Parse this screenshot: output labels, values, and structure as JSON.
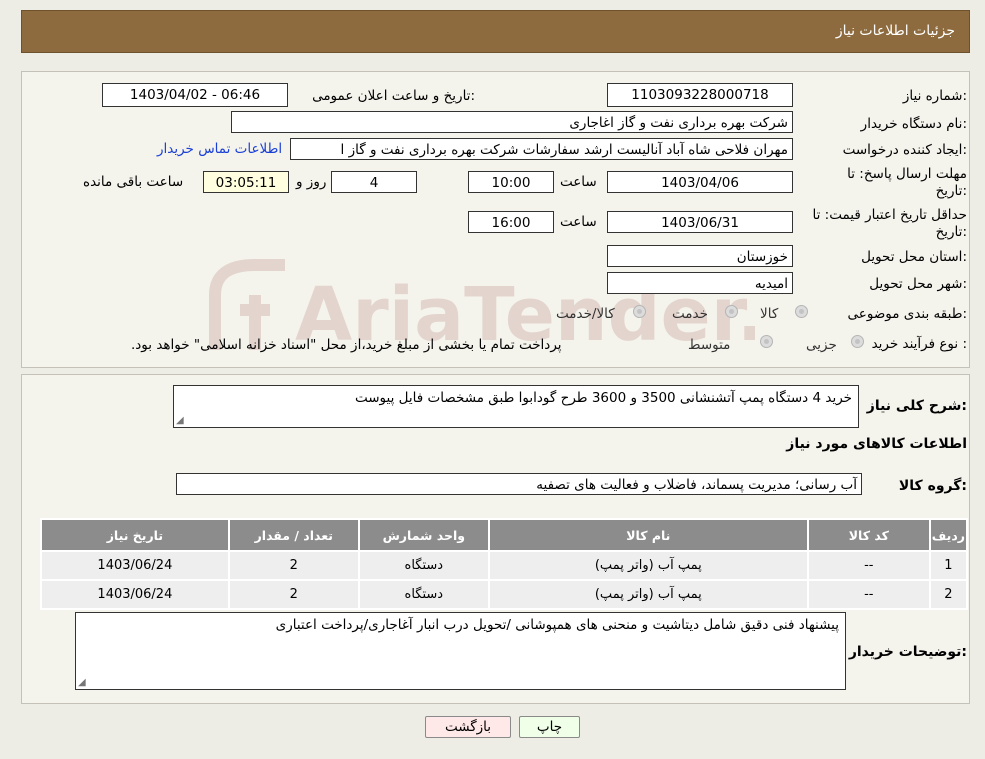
{
  "header": {
    "title": "جزئیات اطلاعات نیاز"
  },
  "form": {
    "need_number_label": "شماره نیاز:",
    "need_number": "1103093228000718",
    "announce_label": "تاریخ و ساعت اعلان عمومی:",
    "announce_value": "1403/04/02 - 06:46",
    "buyer_org_label": "نام دستگاه خریدار:",
    "buyer_org": "شرکت بهره برداری نفت و گاز اغاجاری",
    "creator_label": "ایجاد کننده درخواست:",
    "creator": "مهران فلاحی شاه آباد آنالیست ارشد سفارشات شرکت بهره برداری نفت و گاز ا",
    "contact_link": "اطلاعات تماس خریدار",
    "deadline_label_1": "مهلت ارسال پاسخ: تا",
    "deadline_label_2": "تاریخ:",
    "deadline_date": "1403/04/06",
    "time_label": "ساعت",
    "deadline_time": "10:00",
    "days_value": "4",
    "days_label": "روز و",
    "remaining_time": "03:05:11",
    "remaining_label": "ساعت باقی مانده",
    "validity_label_1": "حداقل تاریخ اعتبار قیمت: تا",
    "validity_label_2": "تاریخ:",
    "validity_date": "1403/06/31",
    "validity_time": "16:00",
    "province_label": "استان محل تحویل:",
    "province": "خوزستان",
    "city_label": "شهر محل تحویل:",
    "city": "امیدیه",
    "category_label": "طبقه بندی موضوعی:",
    "category_options": [
      "کالا",
      "خدمت",
      "کالا/خدمت"
    ],
    "process_label": "نوع فرآیند خرید :",
    "process_options": [
      "جزیی",
      "متوسط"
    ],
    "process_note": "پرداخت تمام یا بخشی از مبلغ خرید،از محل \"اسناد خزانه اسلامی\" خواهد بود."
  },
  "details": {
    "summary_label": "شرح کلی نیاز:",
    "summary": "خرید 4 دستگاه پمپ آتشنشانی 3500 و 3600 طرح گودابوا طبق مشخصات فایل پیوست",
    "goods_info_title": "اطلاعات کالاهای مورد نیاز",
    "goods_group_label": "گروه کالا:",
    "goods_group": "آب رسانی؛ مدیریت پسماند، فاضلاب و فعالیت های تصفیه",
    "table": {
      "headers": [
        "ردیف",
        "کد کالا",
        "نام کالا",
        "واحد شمارش",
        "تعداد / مقدار",
        "تاریخ نیاز"
      ],
      "rows": [
        [
          "1",
          "--",
          "پمپ آب (واتر پمپ)",
          "دستگاه",
          "2",
          "1403/06/24"
        ],
        [
          "2",
          "--",
          "پمپ آب (واتر پمپ)",
          "دستگاه",
          "2",
          "1403/06/24"
        ]
      ]
    },
    "buyer_notes_label": "توضیحات خریدار:",
    "buyer_notes": "پیشنهاد فنی دقیق شامل دیتاشیت و منحنی های همپوشانی /تحویل درب انبار آغاجاری/پرداخت اعتباری"
  },
  "buttons": {
    "print": "چاپ",
    "back": "بازگشت"
  },
  "watermark": {
    "text": "AriaTender.neT"
  },
  "colors": {
    "header_bg": "#8d6b3f",
    "link": "#1a3fd6",
    "print_btn": "#efffe8",
    "back_btn": "#ffe8e8"
  }
}
